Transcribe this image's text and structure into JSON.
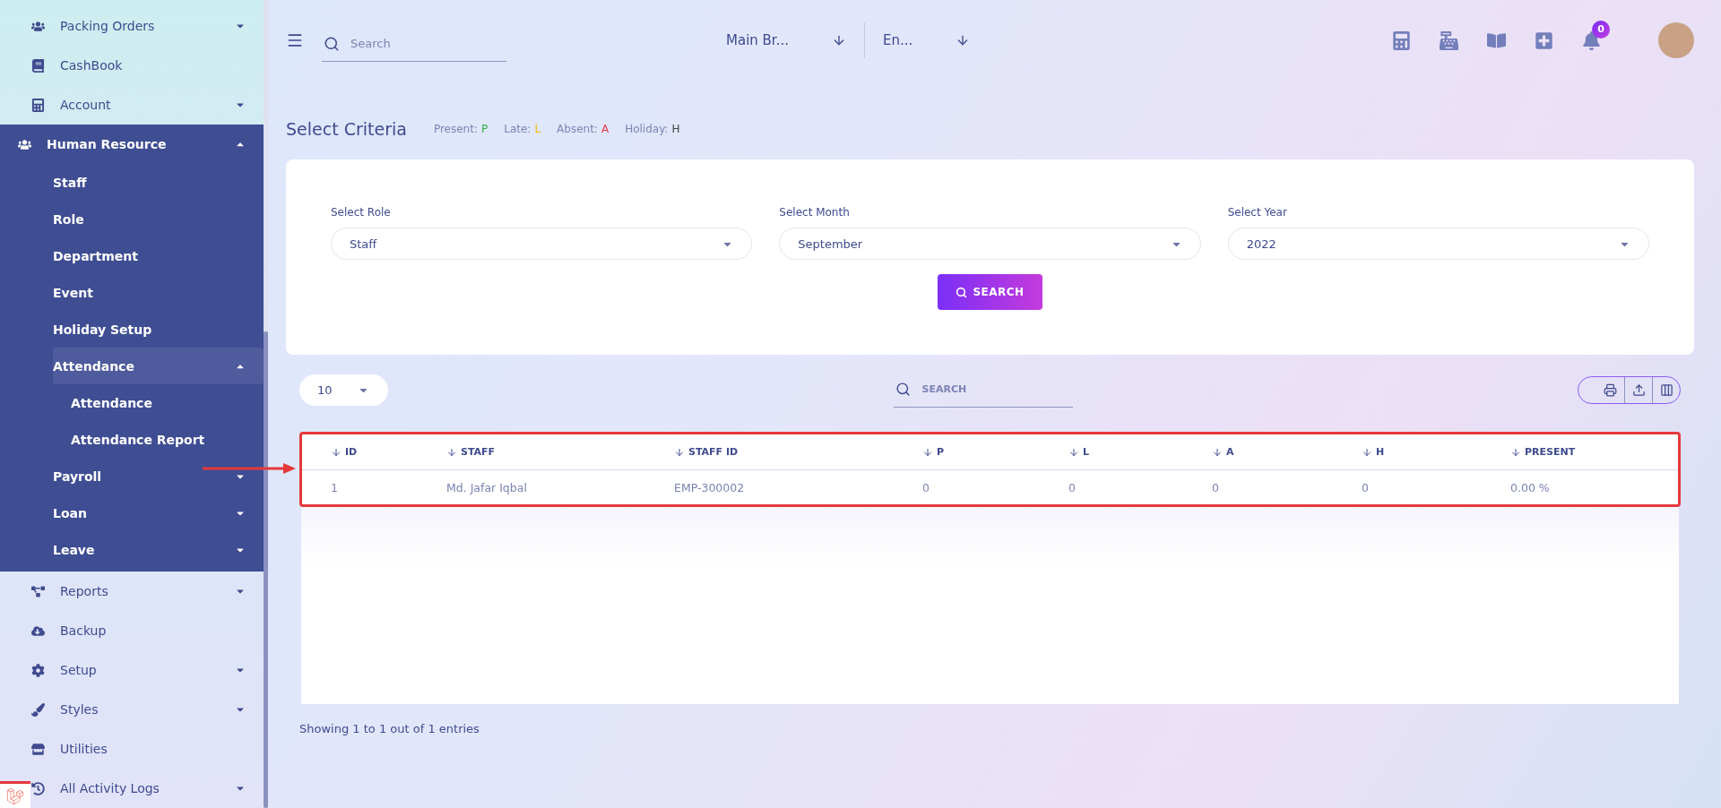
{
  "sidebar": {
    "items": [
      {
        "label": "Packing Orders",
        "expanded": false
      },
      {
        "label": "CashBook"
      },
      {
        "label": "Account",
        "expanded": false
      },
      {
        "label": "Human Resource",
        "expanded": true,
        "children": [
          {
            "label": "Staff",
            "selected": false
          },
          {
            "label": "Role",
            "selected": false
          },
          {
            "label": "Department",
            "selected": false
          },
          {
            "label": "Event",
            "selected": false
          },
          {
            "label": "Holiday Setup",
            "selected": false
          },
          {
            "label": "Attendance",
            "selected": true,
            "expanded": true,
            "children": [
              {
                "label": "Attendance"
              },
              {
                "label": "Attendance Report"
              }
            ]
          },
          {
            "label": "Payroll",
            "selected": false,
            "expanded": false
          },
          {
            "label": "Loan",
            "selected": false,
            "expanded": false
          },
          {
            "label": "Leave",
            "selected": false,
            "expanded": false
          }
        ]
      },
      {
        "label": "Reports",
        "expanded": false
      },
      {
        "label": "Backup"
      },
      {
        "label": "Setup",
        "expanded": false
      },
      {
        "label": "Styles",
        "expanded": false
      },
      {
        "label": "Utilities"
      },
      {
        "label": "All Activity Logs",
        "expanded": false
      }
    ]
  },
  "topbar": {
    "search": {
      "placeholder": "Search"
    },
    "branch": "Main Br...",
    "language": "En...",
    "notifications": "0"
  },
  "criteria": {
    "title": "Select Criteria",
    "legend": [
      {
        "label": "Present:",
        "code": "P",
        "color": "#2fb344"
      },
      {
        "label": "Late:",
        "code": "L",
        "color": "#f5b800"
      },
      {
        "label": "Absent:",
        "code": "A",
        "color": "#e53946"
      },
      {
        "label": "Holiday:",
        "code": "H",
        "color": "#444444"
      }
    ],
    "filters": [
      {
        "label": "Select Role",
        "value": "Staff"
      },
      {
        "label": "Select Month",
        "value": "September"
      },
      {
        "label": "Select Year",
        "value": "2022"
      }
    ],
    "search_button": "SEARCH"
  },
  "table": {
    "page_size": "10",
    "search": {
      "placeholder": "SEARCH"
    },
    "columns": [
      "ID",
      "STAFF",
      "STAFF ID",
      "P",
      "L",
      "A",
      "H",
      "PRESENT"
    ],
    "rows": [
      [
        "1",
        "Md. Jafar Iqbal",
        "EMP-300002",
        "0",
        "0",
        "0",
        "0",
        "0.00 %"
      ]
    ],
    "footer": "Showing 1 to 1 out of 1 entries"
  }
}
